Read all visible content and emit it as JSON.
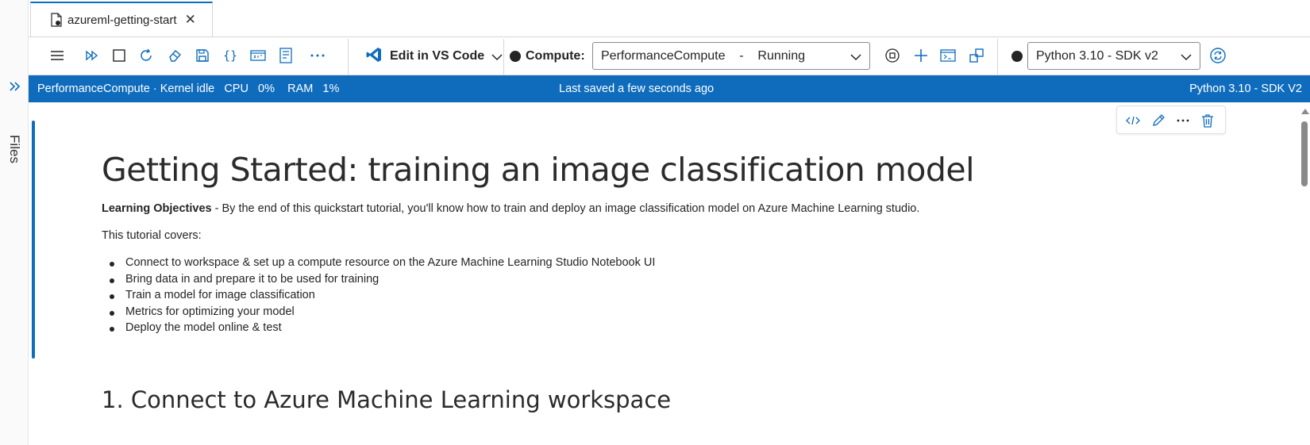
{
  "rail": {
    "collapse_icon": "chevron-double-right-icon",
    "files_label": "Files"
  },
  "tab": {
    "icon": "notebook-file-icon",
    "label": "azureml-getting-start",
    "close_glyph": "✕"
  },
  "toolbar": {
    "icons": [
      "menu-icon",
      "run-all-icon",
      "stop-icon",
      "restart-icon",
      "clear-outputs-icon",
      "save-icon",
      "variables-icon",
      "table-of-contents-icon",
      "outline-icon",
      "more-icon"
    ],
    "edit_in_vscode_label": "Edit in VS Code",
    "compute_label": "Compute:",
    "compute_value": "PerformanceCompute    -    Running",
    "kernel_value": "Python 3.10 - SDK v2"
  },
  "status": {
    "left": "PerformanceCompute · Kernel idle   CPU   0%    RAM   1%",
    "center": "Last saved a few seconds ago",
    "right": "Python 3.10 - SDK V2"
  },
  "cell_tools": [
    "code-icon",
    "edit-icon",
    "more-icon",
    "delete-icon"
  ],
  "notebook": {
    "heading": "Getting Started: training an image classification model",
    "objectives_bold": "Learning Objectives",
    "objectives_text": " - By the end of this quickstart tutorial, you'll know how to train and deploy an image classification model on Azure Machine Learning studio.",
    "covers": "This tutorial covers:",
    "bullets": [
      "Connect to workspace & set up a compute resource on the Azure Machine Learning Studio Notebook UI",
      "Bring data in and prepare it to be used for training",
      "Train a model for image classification",
      "Metrics for optimizing your model",
      "Deploy the model online & test"
    ],
    "section_heading": "1. Connect to Azure Machine Learning workspace"
  },
  "colors": {
    "accent": "#0f6cbd",
    "text": "#242424"
  }
}
